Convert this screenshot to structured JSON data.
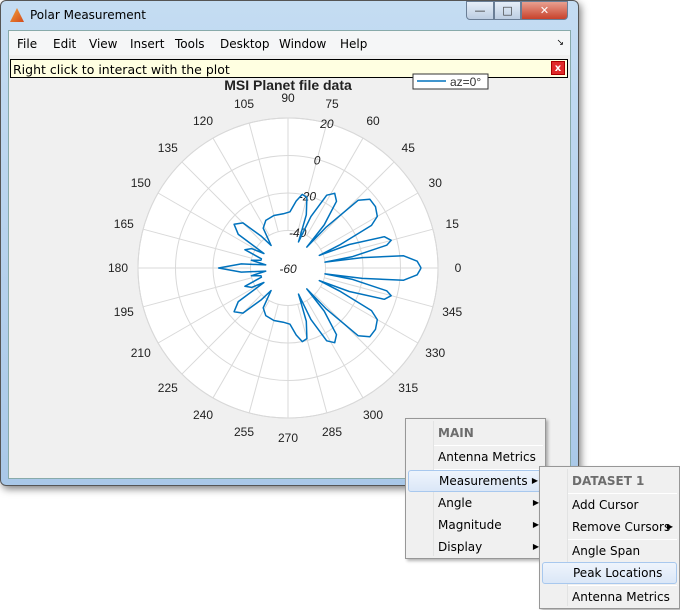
{
  "window": {
    "title": "Polar Measurement",
    "buttons": {
      "minimize": "—",
      "maximize": "□",
      "close": "✕"
    }
  },
  "menubar": {
    "items": [
      "File",
      "Edit",
      "View",
      "Insert",
      "Tools",
      "Desktop",
      "Window",
      "Help"
    ],
    "dock": "↘"
  },
  "infobar": {
    "text": "Right click to interact with the plot",
    "close": "x"
  },
  "chart_data": {
    "type": "polar-line",
    "title": "MSI Planet file data",
    "legend": {
      "entries": [
        "az=0°"
      ],
      "placement": "top-right"
    },
    "series": [
      {
        "name": "az=0°",
        "color": "#0072bd",
        "symmetric_about_0": true,
        "points": [
          [
            0,
            11
          ],
          [
            3,
            9
          ],
          [
            6,
            2
          ],
          [
            8,
            -20
          ],
          [
            9,
            -40
          ],
          [
            10,
            -25
          ],
          [
            13,
            -6
          ],
          [
            15,
            -3
          ],
          [
            18,
            -6
          ],
          [
            21,
            -25
          ],
          [
            22,
            -42
          ],
          [
            24,
            -30
          ],
          [
            27,
            -10
          ],
          [
            30,
            -5
          ],
          [
            35,
            -3
          ],
          [
            40,
            -3
          ],
          [
            44,
            -8
          ],
          [
            47,
            -30
          ],
          [
            48,
            -45
          ],
          [
            50,
            -30
          ],
          [
            54,
            -16
          ],
          [
            58,
            -13
          ],
          [
            62,
            -16
          ],
          [
            66,
            -30
          ],
          [
            68,
            -45
          ],
          [
            71,
            -30
          ],
          [
            75,
            -21
          ],
          [
            79,
            -20
          ],
          [
            83,
            -24
          ],
          [
            88,
            -30
          ],
          [
            95,
            -31
          ],
          [
            105,
            -31
          ],
          [
            115,
            -32
          ],
          [
            122,
            -35
          ],
          [
            127,
            -45
          ],
          [
            130,
            -38
          ],
          [
            135,
            -26
          ],
          [
            141,
            -23
          ],
          [
            146,
            -28
          ],
          [
            149,
            -45
          ],
          [
            152,
            -38
          ],
          [
            157,
            -35
          ],
          [
            161,
            -45
          ],
          [
            164,
            -45
          ],
          [
            168,
            -40
          ],
          [
            172,
            -48
          ],
          [
            175,
            -35
          ],
          [
            180,
            -23
          ]
        ]
      }
    ],
    "angle_ticks": [
      0,
      15,
      30,
      45,
      60,
      75,
      90,
      105,
      120,
      135,
      150,
      165,
      180,
      195,
      210,
      225,
      240,
      255,
      270,
      285,
      300,
      315,
      330,
      345
    ],
    "magnitude_ticks": [
      -60,
      -40,
      -20,
      0,
      20
    ],
    "magnitude_range": [
      -60,
      20
    ],
    "grid": true
  },
  "context_menu": {
    "header": "MAIN",
    "items": [
      {
        "label": "Antenna Metrics"
      },
      {
        "label": "Measurements",
        "submenu": true,
        "selected": true
      },
      {
        "label": "Angle",
        "submenu": true
      },
      {
        "label": "Magnitude",
        "submenu": true
      },
      {
        "label": "Display",
        "submenu": true
      }
    ]
  },
  "submenu": {
    "header": "DATASET 1",
    "items": [
      {
        "label": "Add Cursor"
      },
      {
        "label": "Remove Cursors",
        "submenu": true
      },
      {
        "label": "Angle Span"
      },
      {
        "label": "Peak Locations",
        "selected": true
      },
      {
        "label": "Antenna Metrics"
      }
    ]
  }
}
